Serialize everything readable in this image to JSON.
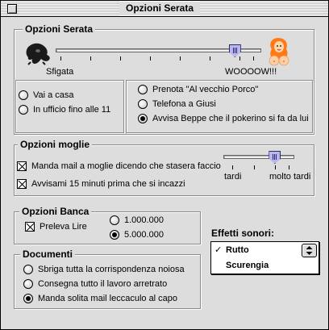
{
  "window": {
    "title": "Opzioni Serata"
  },
  "serata": {
    "title": "Opzioni Serata",
    "slider_left_label": "Sfigata",
    "slider_right_label": "WOOOOW!!!",
    "slider_value_fraction": 0.87,
    "left_options": [
      {
        "label": "Vai a casa",
        "selected": false
      },
      {
        "label": "In ufficio fino alle 11",
        "selected": false
      }
    ],
    "right_options": [
      {
        "label": "Prenota \"Al vecchio Porco\"",
        "selected": false
      },
      {
        "label": "Telefona a Giusi",
        "selected": false
      },
      {
        "label": "Avvisa Beppe che il pokerino si fa da lui",
        "selected": true
      }
    ]
  },
  "moglie": {
    "title": "Opzioni moglie",
    "checkboxes": [
      {
        "label": "Manda mail a moglie dicendo che stasera faccio",
        "checked": true
      },
      {
        "label": "Avvisami 15 minuti prima che si incazzi",
        "checked": true
      }
    ],
    "slider_left_label": "tardi",
    "slider_right_label": "molto tardi",
    "slider_value_fraction": 0.72
  },
  "banca": {
    "title": "Opzioni Banca",
    "checkbox": {
      "label": "Preleva Lire",
      "checked": true
    },
    "amounts": [
      {
        "label": "1.000.000",
        "selected": false
      },
      {
        "label": "5.000.000",
        "selected": true
      }
    ]
  },
  "effetti": {
    "label": "Effetti sonori:",
    "options": [
      {
        "label": "Rutto",
        "selected": true
      },
      {
        "label": "Scurengia",
        "selected": false
      }
    ],
    "check_mark": "✓"
  },
  "documenti": {
    "title": "Documenti",
    "options": [
      {
        "label": "Sbriga tutta la corrispondenza noiosa",
        "selected": false
      },
      {
        "label": "Consegna tutto il lavoro arretrato",
        "selected": false
      },
      {
        "label": "Manda solita mail leccaculo al capo",
        "selected": true
      }
    ]
  },
  "icons": {
    "left_slider_icon": "gorilla-icon",
    "right_slider_icon": "woman-icon",
    "close_box": "close-box-icon"
  }
}
